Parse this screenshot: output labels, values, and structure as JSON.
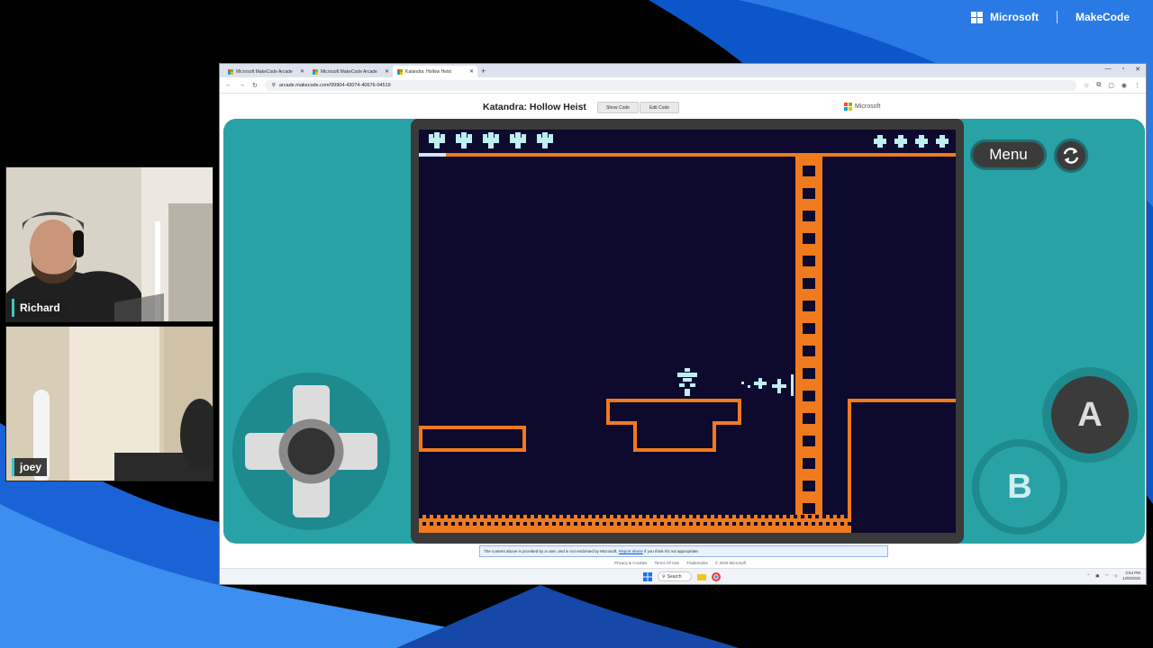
{
  "brand": {
    "microsoft": "Microsoft",
    "makecode": "MakeCode"
  },
  "participants": [
    {
      "name": "Richard"
    },
    {
      "name": "joey"
    }
  ],
  "browser": {
    "tabs": [
      {
        "label": "Microsoft MakeCode Arcade",
        "active": false
      },
      {
        "label": "Microsoft MakeCode Arcade",
        "active": false
      },
      {
        "label": "Katandra: Hollow Heist",
        "active": true
      }
    ],
    "url": "arcade.makecode.com/99904-43074-40676-04519"
  },
  "page": {
    "title": "Katandra: Hollow Heist",
    "show_code": "Show Code",
    "edit_code": "Edit Code",
    "microsoft": "Microsoft"
  },
  "simulator": {
    "menu": "Menu",
    "button_a": "A",
    "button_b": "B",
    "left_lives": 5,
    "right_lives": 4,
    "colors": {
      "accent": "#f07a1e",
      "bg": "#0d0a2e",
      "player": "#bfeef0",
      "case": "#28a2a5"
    }
  },
  "footer": {
    "disclaimer_start": "The content above is provided by a user, and is not endorsed by Microsoft.",
    "report_abuse": "Report abuse",
    "disclaimer_end": "if you think it's not appropriate.",
    "links": [
      "Privacy & Cookies",
      "Terms Of Use",
      "Trademarks",
      "© 2025 Microsoft"
    ]
  },
  "taskbar": {
    "search": "Search",
    "time": "3:54 PM",
    "date": "12/8/2025"
  }
}
